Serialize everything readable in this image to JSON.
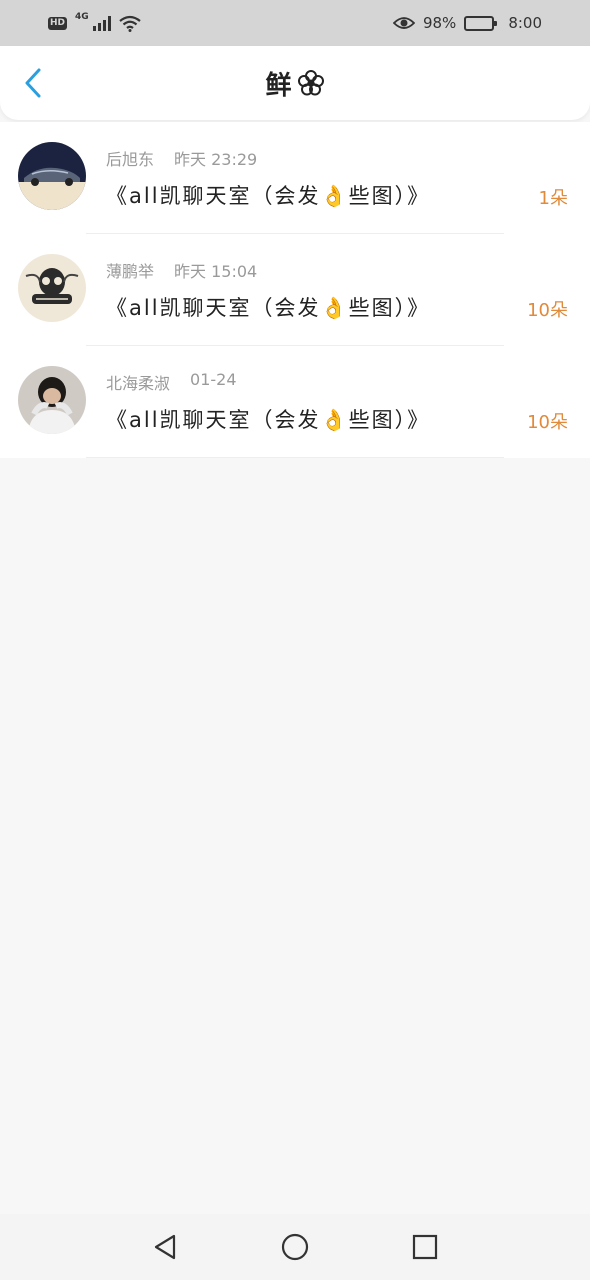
{
  "status_bar": {
    "hd": "HD",
    "network": "4G",
    "battery_percent": "98%",
    "time": "8:00",
    "icons": [
      "signal-icon",
      "wifi-icon",
      "eye-icon",
      "battery-icon"
    ]
  },
  "header": {
    "title": "鲜",
    "title_icon": "flower-icon",
    "back_icon": "back-chevron-icon"
  },
  "colors": {
    "accent_blue": "#2a9fe0",
    "count_orange": "#e08a3a",
    "meta_gray": "#9a9a9a"
  },
  "items": [
    {
      "name": "后旭东",
      "time": "昨天 23:29",
      "message": "《all凯聊天室（会发👌些图）》",
      "count": "1朵",
      "avatar": "car-avatar"
    },
    {
      "name": "薄鹏举",
      "time": "昨天 15:04",
      "message": "《all凯聊天室（会发👌些图）》",
      "count": "10朵",
      "avatar": "skull-avatar"
    },
    {
      "name": "北海柔淑",
      "time": "01-24",
      "message": "《all凯聊天室（会发👌些图）》",
      "count": "10朵",
      "avatar": "person-avatar"
    }
  ],
  "bottom_nav": {
    "icons": [
      "nav-back-icon",
      "nav-home-icon",
      "nav-recents-icon"
    ]
  }
}
